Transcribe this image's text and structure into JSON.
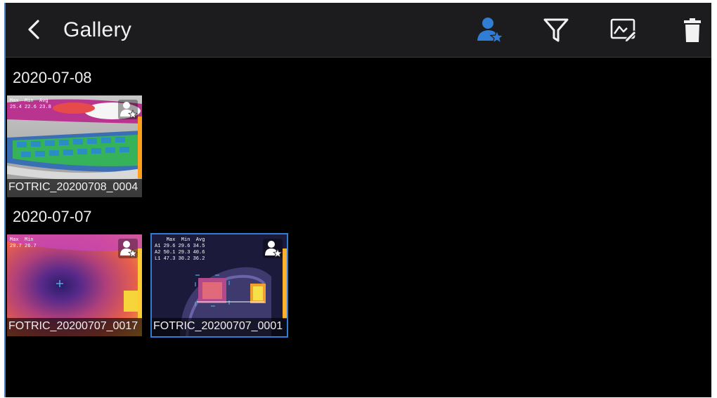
{
  "header": {
    "title": "Gallery",
    "icons": [
      "back-icon",
      "favorite-user-icon",
      "filter-icon",
      "edit-image-icon",
      "trash-icon"
    ],
    "accent_color": "#2f7dd4"
  },
  "groups": [
    {
      "date": "2020-07-08",
      "items": [
        {
          "name": "FOTRIC_20200708_0004",
          "overlay": "Max  Min  Avg\n25.4 22.6 23.8",
          "selected": false
        }
      ]
    },
    {
      "date": "2020-07-07",
      "items": [
        {
          "name": "FOTRIC_20200707_0017",
          "overlay": "Max  Min\n29.7 26.7",
          "selected": false
        },
        {
          "name": "FOTRIC_20200707_0001",
          "overlay": "    Max  Min  Avg\nA1 29.6 29.6 34.5\nA2 50.1 29.3 40.6\nL1 47.3 30.2 36.2",
          "selected": true
        }
      ]
    }
  ]
}
